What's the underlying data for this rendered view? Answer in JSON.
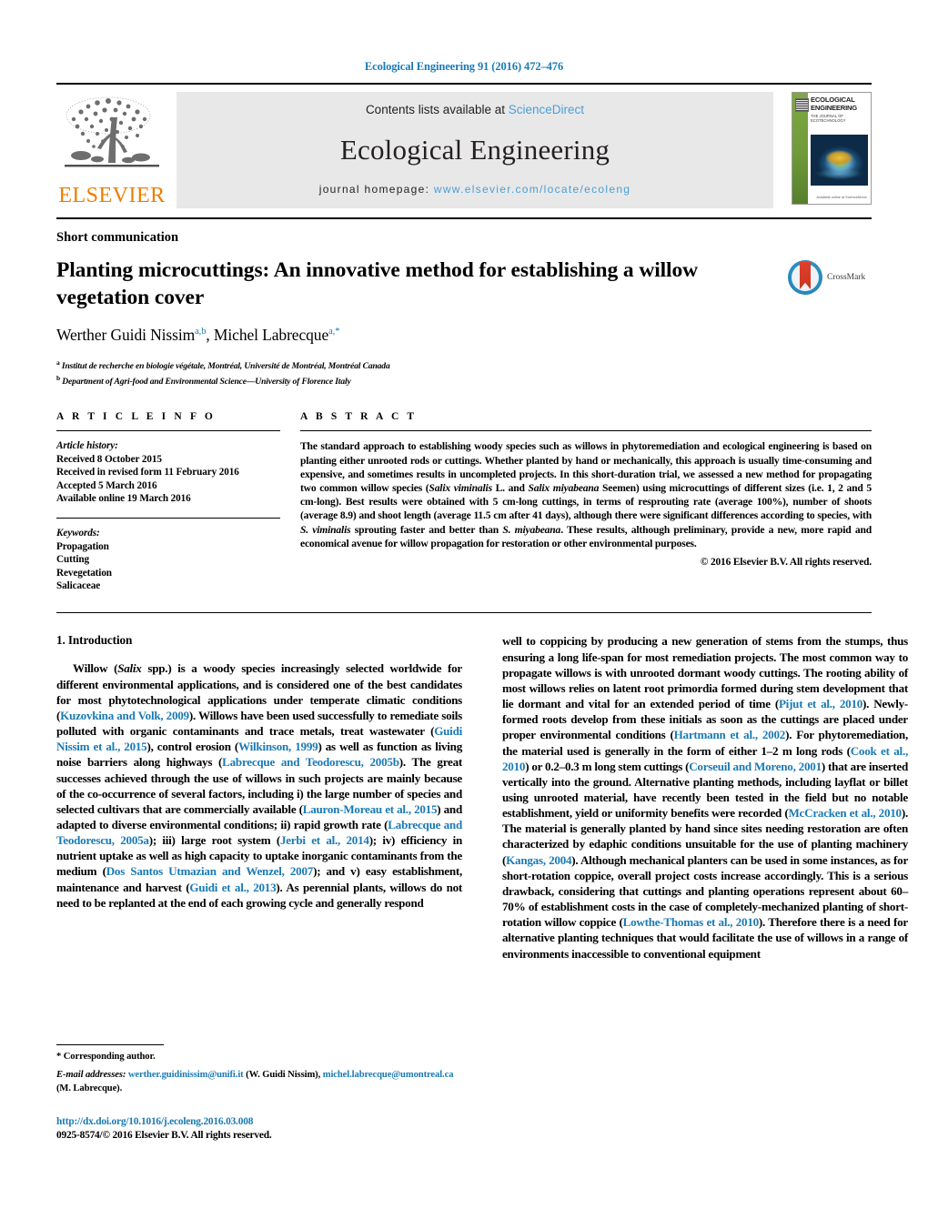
{
  "running_head": "Ecological Engineering 91 (2016) 472–476",
  "banner": {
    "contents_prefix": "Contents lists available at ",
    "sciencedirect": "ScienceDirect",
    "journal_title": "Ecological Engineering",
    "homepage_prefix": "journal homepage: ",
    "homepage_url": "www.elsevier.com/locate/ecoleng",
    "publisher": "ELSEVIER",
    "cover": {
      "title": "ECOLOGICAL ENGINEERING",
      "subtitle": "THE JOURNAL OF ECOTECHNOLOGY",
      "footer": "Available online at\nScienceDirect"
    },
    "colors": {
      "link": "#4a9fd5",
      "panel": "#e8e8e8",
      "elsevier_orange": "#ef7d00",
      "cover_green": "#6f9b39"
    }
  },
  "article": {
    "type_label": "Short communication",
    "title": "Planting microcuttings: An innovative method for establishing a willow vegetation cover",
    "authors_html": "Werther Guidi Nissim<sup>a,b</sup>, Michel Labrecque<sup>a,</sup><sup>*</sup>",
    "affiliations": [
      {
        "marker": "a",
        "text": "Institut de recherche en biologie végétale, Montréal, Université de Montréal, Montréal Canada"
      },
      {
        "marker": "b",
        "text": "Department of Agri-food and Environmental Science—University of Florence Italy"
      }
    ],
    "crossmark_label": "CrossMark"
  },
  "article_info": {
    "heading": "A R T I C L E   I N F O",
    "history_label": "Article history:",
    "history": [
      "Received 8 October 2015",
      "Received in revised form 11 February 2016",
      "Accepted 5 March 2016",
      "Available online 19 March 2016"
    ],
    "keywords_label": "Keywords:",
    "keywords": [
      "Propagation",
      "Cutting",
      "Revegetation",
      "Salicaceae"
    ]
  },
  "abstract": {
    "heading": "A B S T R A C T",
    "text_html": "The standard approach to establishing woody species such as willows in phytoremediation and ecological engineering is based on planting either unrooted rods or cuttings. Whether planted by hand or mechanically, this approach is usually time-consuming and expensive, and sometimes results in uncompleted projects. In this short-duration trial, we assessed a new method for propagating two common willow species (<i>Salix viminalis</i> L. and <i>Salix miyabeana</i> Seemen) using microcuttings of different sizes (i.e. 1, 2 and 5 cm-long). Best results were obtained with 5 cm-long cuttings, in terms of resprouting rate (average 100%), number of shoots (average 8.9) and shoot length (average 11.5 cm after 41 days), although there were significant differences according to species, with <i>S. viminalis</i> sprouting faster and better than <i>S. miyabeana</i>. These results, although preliminary, provide a new, more rapid and economical avenue for willow propagation for restoration or other environmental purposes.",
    "copyright": "© 2016 Elsevier B.V. All rights reserved."
  },
  "body": {
    "section_title": "1.  Introduction",
    "left_paragraph_html": "Willow (<i>Salix</i> spp.) is a woody species increasingly selected worldwide for different environmental applications, and is considered one of the best candidates for most phytotechnological applications under temperate climatic conditions (<a class=\"ref\">Kuzovkina and Volk, 2009</a>). Willows have been used successfully to remediate soils polluted with organic contaminants and trace metals, treat wastewater (<a class=\"ref\">Guidi Nissim et al., 2015</a>), control erosion (<a class=\"ref\">Wilkinson, 1999</a>) as well as function as living noise barriers along highways (<a class=\"ref\">Labrecque and Teodorescu, 2005b</a>). The great successes achieved through the use of willows in such projects are mainly because of the co-occurrence of several factors, including i) the large number of species and selected cultivars that are commercially available (<a class=\"ref\">Lauron-Moreau et al., 2015</a>) and adapted to diverse environmental conditions; ii) rapid growth rate (<a class=\"ref\">Labrecque and Teodorescu, 2005a</a>); iii) large root system (<a class=\"ref\">Jerbi et al., 2014</a>); iv) efficiency in nutrient uptake as well as high capacity to uptake inorganic contaminants from the medium (<a class=\"ref\">Dos Santos Utmazian and Wenzel, 2007</a>); and v) easy establishment, maintenance and harvest (<a class=\"ref\">Guidi et al., 2013</a>). As perennial plants, willows do not need to be replanted at the end of each growing cycle and generally respond",
    "right_paragraph_html": "well to coppicing by producing a new generation of stems from the stumps, thus ensuring a long life-span for most remediation projects. The most common way to propagate willows is with unrooted dormant woody cuttings. The rooting ability of most willows relies on latent root primordia formed during stem development that lie dormant and vital for an extended period of time (<a class=\"ref\">Pijut et al., 2010</a>). Newly-formed roots develop from these initials as soon as the cuttings are placed under proper environmental conditions (<a class=\"ref\">Hartmann et al., 2002</a>). For phytoremediation, the material used is generally in the form of either 1–2 m long rods (<a class=\"ref\">Cook et al., 2010</a>) or 0.2–0.3 m long stem cuttings (<a class=\"ref\">Corseuil and Moreno, 2001</a>) that are inserted vertically into the ground. Alternative planting methods, including layflat or billet using unrooted material, have recently been tested in the field but no notable establishment, yield or uniformity benefits were recorded (<a class=\"ref\">McCracken et al., 2010</a>). The material is generally planted by hand since sites needing restoration are often characterized by edaphic conditions unsuitable for the use of planting machinery (<a class=\"ref\">Kangas, 2004</a>). Although mechanical planters can be used in some instances, as for short-rotation coppice, overall project costs increase accordingly. This is a serious drawback, considering that cuttings and planting operations represent about 60–70% of establishment costs in the case of completely-mechanized planting of short-rotation willow coppice (<a class=\"ref\">Lowthe-Thomas et al., 2010</a>). Therefore there is a need for alternative planting techniques that would facilitate the use of willows in a range of environments inaccessible to conventional equipment"
  },
  "footnote": {
    "corresponding": "*  Corresponding author.",
    "email_label": "E-mail addresses:",
    "email_1": "werther.guidinissim@unifi.it",
    "email_1_name": "(W. Guidi Nissim),",
    "email_2": "michel.labrecque@umontreal.ca",
    "email_2_name": "(M. Labrecque).",
    "doi": "http://dx.doi.org/10.1016/j.ecoleng.2016.03.008",
    "issn": "0925-8574/© 2016 Elsevier B.V. All rights reserved."
  }
}
